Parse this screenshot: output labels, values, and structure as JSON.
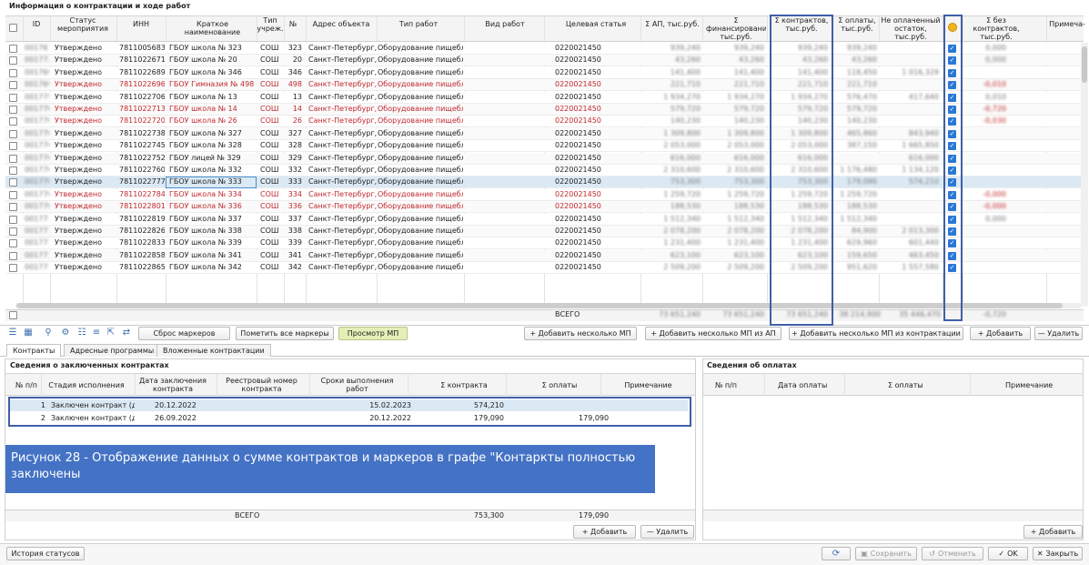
{
  "main_panel": {
    "title": "Информация о контрактации и ходе работ",
    "columns": [
      {
        "key": "id",
        "label": "ID"
      },
      {
        "key": "status",
        "label": "Статус мероприятия"
      },
      {
        "key": "inn",
        "label": "ИНН"
      },
      {
        "key": "short_name",
        "label": "Краткое наименование"
      },
      {
        "key": "type",
        "label": "Тип учреж."
      },
      {
        "key": "num",
        "label": "№"
      },
      {
        "key": "address",
        "label": "Адрес объекта"
      },
      {
        "key": "work_type",
        "label": "Тип работ"
      },
      {
        "key": "work_kind",
        "label": "Вид работ"
      },
      {
        "key": "target",
        "label": "Целевая статья"
      },
      {
        "key": "sum_ap",
        "label": "Σ АП, тыс.руб."
      },
      {
        "key": "sum_fin",
        "label": "Σ финансирования, тыс.руб."
      },
      {
        "key": "sum_contracts",
        "label": "Σ контрактов, тыс.руб."
      },
      {
        "key": "sum_pay",
        "label": "Σ оплаты, тыс.руб."
      },
      {
        "key": "unpaid",
        "label": "Не оплаченный остаток, тыс.руб."
      },
      {
        "key": "marker",
        "label": ""
      },
      {
        "key": "no_contracts",
        "label": "Σ без контрактов, тыс.руб."
      },
      {
        "key": "note",
        "label": "Примеча-"
      }
    ],
    "rows": [
      {
        "id": "0017670",
        "status": "Утверждено",
        "inn": "7811005683",
        "name": "ГБОУ школа № 323",
        "type": "СОШ",
        "num": "323",
        "addr": "Санкт-Петербург, г",
        "work": "Оборудование пищебл",
        "target": "0220021450",
        "ap": "939,240",
        "fin": "939,240",
        "con": "939,240",
        "pay": "939,240",
        "unp": "",
        "nc": "0,000",
        "red": false
      },
      {
        "id": "0017722",
        "status": "Утверждено",
        "inn": "7811022671",
        "name": "ГБОУ школа № 20",
        "type": "СОШ",
        "num": "20",
        "addr": "Санкт-Петербург, г",
        "work": "Оборудование пищебл",
        "target": "0220021450",
        "ap": "43,260",
        "fin": "43,260",
        "con": "43,260",
        "pay": "43,260",
        "unp": "",
        "nc": "0,000",
        "red": false
      },
      {
        "id": "0017699",
        "status": "Утверждено",
        "inn": "7811022689",
        "name": "ГБОУ школа № 346",
        "type": "СОШ",
        "num": "346",
        "addr": "Санкт-Петербург, у",
        "work": "Оборудование пищебл",
        "target": "0220021450",
        "ap": "141,400",
        "fin": "141,400",
        "con": "141,400",
        "pay": "118,450",
        "unp": "1 016,329",
        "nc": "",
        "red": false
      },
      {
        "id": "0017698",
        "status": "Утверждено",
        "inn": "7811022696",
        "name": "ГБОУ Гимназия № 498",
        "type": "СОШ",
        "num": "498",
        "addr": "Санкт-Петербург, у",
        "work": "Оборудование пищебл",
        "target": "0220021450",
        "ap": "221,710",
        "fin": "221,710",
        "con": "221,710",
        "pay": "221,710",
        "unp": "",
        "nc": "-0,010",
        "red": true
      },
      {
        "id": "0017756",
        "status": "Утверждено",
        "inn": "7811022706",
        "name": "ГБОУ школа № 13",
        "type": "СОШ",
        "num": "13",
        "addr": "Санкт-Петербург, у",
        "work": "Оборудование пищебл",
        "target": "0220021450",
        "ap": "1 934,270",
        "fin": "1 934,270",
        "con": "1 934,270",
        "pay": "576,470",
        "unp": "417,640",
        "nc": "0,010",
        "red": false
      },
      {
        "id": "0017700",
        "status": "Утверждено",
        "inn": "7811022713",
        "name": "ГБОУ школа № 14",
        "type": "СОШ",
        "num": "14",
        "addr": "Санкт-Петербург, у",
        "work": "Оборудование пищебл",
        "target": "0220021450",
        "ap": "579,720",
        "fin": "579,720",
        "con": "579,720",
        "pay": "579,720",
        "unp": "",
        "nc": "-0,720",
        "red": true
      },
      {
        "id": "0017701",
        "status": "Утверждено",
        "inn": "7811022720",
        "name": "ГБОУ школа № 26",
        "type": "СОШ",
        "num": "26",
        "addr": "Санкт-Петербург, Т",
        "work": "Оборудование пищебл",
        "target": "0220021450",
        "ap": "140,230",
        "fin": "140,230",
        "con": "140,230",
        "pay": "140,230",
        "unp": "",
        "nc": "-0,030",
        "red": true
      },
      {
        "id": "0017702",
        "status": "Утверждено",
        "inn": "7811022738",
        "name": "ГБОУ школа № 327",
        "type": "СОШ",
        "num": "327",
        "addr": "Санкт-Петербург, у",
        "work": "Оборудование пищебл",
        "target": "0220021450",
        "ap": "1 309,800",
        "fin": "1 309,800",
        "con": "1 309,800",
        "pay": "465,860",
        "unp": "843,940",
        "nc": "",
        "red": false
      },
      {
        "id": "0017703",
        "status": "Утверждено",
        "inn": "7811022745",
        "name": "ГБОУ школа № 328",
        "type": "СОШ",
        "num": "328",
        "addr": "Санкт-Петербург, у",
        "work": "Оборудование пищебл",
        "target": "0220021450",
        "ap": "2 053,000",
        "fin": "2 053,000",
        "con": "2 053,000",
        "pay": "387,150",
        "unp": "1 665,850",
        "nc": "",
        "red": false
      },
      {
        "id": "0017704",
        "status": "Утверждено",
        "inn": "7811022752",
        "name": "ГБОУ лицей № 329",
        "type": "СОШ",
        "num": "329",
        "addr": "Санкт-Петербург, у",
        "work": "Оборудование пищебл",
        "target": "0220021450",
        "ap": "616,000",
        "fin": "616,000",
        "con": "616,000",
        "pay": "",
        "unp": "616,000",
        "nc": "",
        "red": false
      },
      {
        "id": "0017706",
        "status": "Утверждено",
        "inn": "7811022760",
        "name": "ГБОУ школа № 332",
        "type": "СОШ",
        "num": "332",
        "addr": "Санкт-Петербург, Т",
        "work": "Оборудование пищебл",
        "target": "0220021450",
        "ap": "2 310,600",
        "fin": "2 310,600",
        "con": "2 310,600",
        "pay": "1 176,480",
        "unp": "1 134,120",
        "nc": "",
        "red": false
      },
      {
        "id": "0017707",
        "status": "Утверждено",
        "inn": "7811022777",
        "name": "ГБОУ школа № 333",
        "type": "СОШ",
        "num": "333",
        "addr": "Санкт-Петербург, у",
        "work": "Оборудование пищебл",
        "target": "0220021450",
        "ap": "753,300",
        "fin": "753,300",
        "con": "753,300",
        "pay": "179,090",
        "unp": "574,210",
        "nc": "",
        "red": false,
        "selected": true
      },
      {
        "id": "0017708",
        "status": "Утверждено",
        "inn": "7811022784",
        "name": "ГБОУ школа № 334",
        "type": "СОШ",
        "num": "334",
        "addr": "Санкт-Петербург, у",
        "work": "Оборудование пищебл",
        "target": "0220021450",
        "ap": "1 259,720",
        "fin": "1 259,720",
        "con": "1 259,720",
        "pay": "1 259,720",
        "unp": "",
        "nc": "-0,000",
        "red": true
      },
      {
        "id": "0017709",
        "status": "Утверждено",
        "inn": "7811022801",
        "name": "ГБОУ школа № 336",
        "type": "СОШ",
        "num": "336",
        "addr": "Санкт-Петербург, у",
        "work": "Оборудование пищебл",
        "target": "0220021450",
        "ap": "188,530",
        "fin": "188,530",
        "con": "188,530",
        "pay": "188,530",
        "unp": "",
        "nc": "-0,000",
        "red": true
      },
      {
        "id": "0017710",
        "status": "Утверждено",
        "inn": "7811022819",
        "name": "ГБОУ школа № 337",
        "type": "СОШ",
        "num": "337",
        "addr": "Санкт-Петербург, у",
        "work": "Оборудование пищебл",
        "target": "0220021450",
        "ap": "1 512,340",
        "fin": "1 512,340",
        "con": "1 512,340",
        "pay": "1 512,340",
        "unp": "",
        "nc": "0,000",
        "red": false
      },
      {
        "id": "0017711",
        "status": "Утверждено",
        "inn": "7811022826",
        "name": "ГБОУ школа № 338",
        "type": "СОШ",
        "num": "338",
        "addr": "Санкт-Петербург, (",
        "work": "Оборудование пищебл",
        "target": "0220021450",
        "ap": "2 078,200",
        "fin": "2 078,200",
        "con": "2 078,200",
        "pay": "84,900",
        "unp": "2 013,300",
        "nc": "",
        "red": false
      },
      {
        "id": "0017712",
        "status": "Утверждено",
        "inn": "7811022833",
        "name": "ГБОУ школа № 339",
        "type": "СОШ",
        "num": "339",
        "addr": "Санкт-Петербург, у",
        "work": "Оборудование пищебл",
        "target": "0220021450",
        "ap": "1 231,400",
        "fin": "1 231,400",
        "con": "1 231,400",
        "pay": "629,960",
        "unp": "601,440",
        "nc": "",
        "red": false
      },
      {
        "id": "0017713",
        "status": "Утверждено",
        "inn": "7811022858",
        "name": "ГБОУ школа № 341",
        "type": "СОШ",
        "num": "341",
        "addr": "Санкт-Петербург, у",
        "work": "Оборудование пищебл",
        "target": "0220021450",
        "ap": "623,100",
        "fin": "623,100",
        "con": "623,100",
        "pay": "159,650",
        "unp": "463,450",
        "nc": "",
        "red": false
      },
      {
        "id": "0017714",
        "status": "Утверждено",
        "inn": "7811022865",
        "name": "ГБОУ школа № 342",
        "type": "СОШ",
        "num": "342",
        "addr": "Санкт-Петербург, у",
        "work": "Оборудование пищебл",
        "target": "0220021450",
        "ap": "2 509,200",
        "fin": "2 509,200",
        "con": "2 509,200",
        "pay": "951,620",
        "unp": "1 557,580",
        "nc": "",
        "red": false
      }
    ],
    "total_row": {
      "target": "ВСЕГО",
      "ap": "73 651,240",
      "fin": "73 651,240",
      "con": "73 651,240",
      "pay": "38 214,900",
      "unp": "35 446,470",
      "nc": "-0,720"
    }
  },
  "toolbar": {
    "reset_markers": "Сброс маркеров",
    "mark_all": "Пометить все маркеры",
    "view_mp": "Просмотр МП",
    "add_many_mp": "+ Добавить несколько МП",
    "add_many_mp_ap": "+ Добавить несколько МП из АП",
    "add_many_mp_contract": "+ Добавить несколько МП из контрактации",
    "add": "+ Добавить",
    "delete": "— Удалить"
  },
  "tabs": [
    "Контракты",
    "Адресные программы",
    "Вложенные контрактации"
  ],
  "contracts": {
    "title": "Сведения о заключенных контрактах",
    "columns": [
      "№ п/п",
      "Стадия исполнения",
      "Дата заключения контракта",
      "Реестровый номер контракта",
      "Сроки выполнения работ",
      "Σ контракта",
      "Σ оплаты",
      "Примечание"
    ],
    "rows": [
      {
        "n": "1",
        "stage": "Заключен контракт (догов",
        "date": "20.12.2022",
        "reg": "",
        "term": "15.02.2023",
        "sum": "574,210",
        "pay": "",
        "note": ""
      },
      {
        "n": "2",
        "stage": "Заключен контракт (догов",
        "date": "26.09.2022",
        "reg": "",
        "term": "20.12.2022",
        "sum": "179,090",
        "pay": "179,090",
        "note": ""
      }
    ],
    "total": {
      "label": "ВСЕГО",
      "sum": "753,300",
      "pay": "179,090"
    },
    "add": "+ Добавить",
    "delete": "— Удалить"
  },
  "caption": "Рисунок 28 - Отображение данных о сумме контрактов и маркеров в графе \"Контаркты полностью заключены",
  "payments": {
    "title": "Сведения об оплатах",
    "columns": [
      "№ п/п",
      "Дата оплаты",
      "Σ оплаты",
      "Примечание"
    ],
    "add": "+ Добавить"
  },
  "footer": {
    "history": "История статусов",
    "save": "Сохранить",
    "cancel": "Отменить",
    "ok": "OK",
    "close": "Закрыть"
  },
  "colors": {
    "accent": "#3f6fb0",
    "highlight_border": "#3f5fa8",
    "caption_bg": "#4472c4",
    "selected_row": "#dbe9f4",
    "red_text": "#c0282d",
    "checkbox": "#2a78d6"
  }
}
